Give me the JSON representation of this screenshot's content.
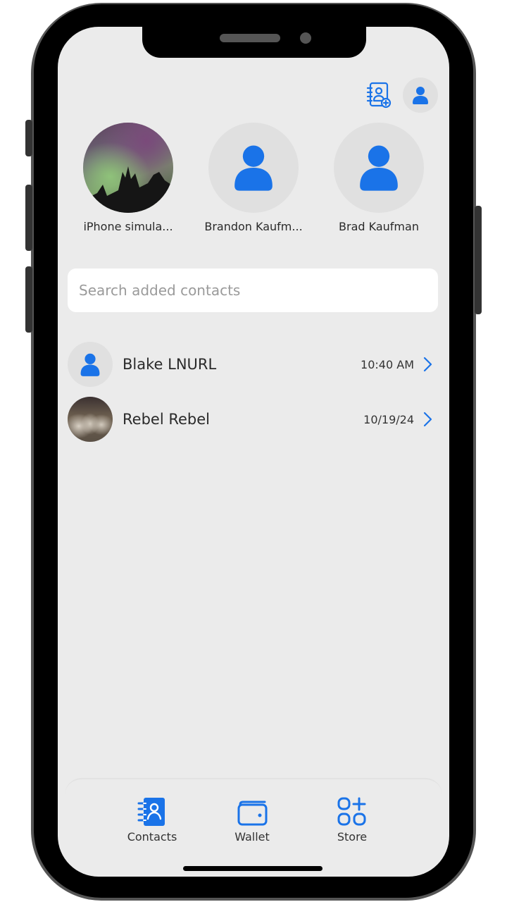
{
  "header": {
    "add_contact_icon": "contact-book-plus-icon",
    "profile_icon": "person-icon"
  },
  "recent_contacts": [
    {
      "name": "iPhone simula...",
      "avatar": "photo-aurora"
    },
    {
      "name": "Brandon Kaufm...",
      "avatar": "person-icon"
    },
    {
      "name": "Brad Kaufman",
      "avatar": "person-icon"
    }
  ],
  "search": {
    "placeholder": "Search added contacts",
    "value": ""
  },
  "contacts": [
    {
      "name": "Blake LNURL",
      "time": "10:40 AM",
      "avatar": "person-icon"
    },
    {
      "name": "Rebel Rebel",
      "time": "10/19/24",
      "avatar": "photo"
    }
  ],
  "tabbar": {
    "tabs": [
      {
        "label": "Contacts",
        "icon": "contacts-book-icon",
        "active": true
      },
      {
        "label": "Wallet",
        "icon": "wallet-icon",
        "active": false
      },
      {
        "label": "Store",
        "icon": "apps-plus-icon",
        "active": false
      }
    ]
  },
  "colors": {
    "accent": "#1a73e8",
    "background": "#ebebeb",
    "text": "#2a2a2a"
  }
}
